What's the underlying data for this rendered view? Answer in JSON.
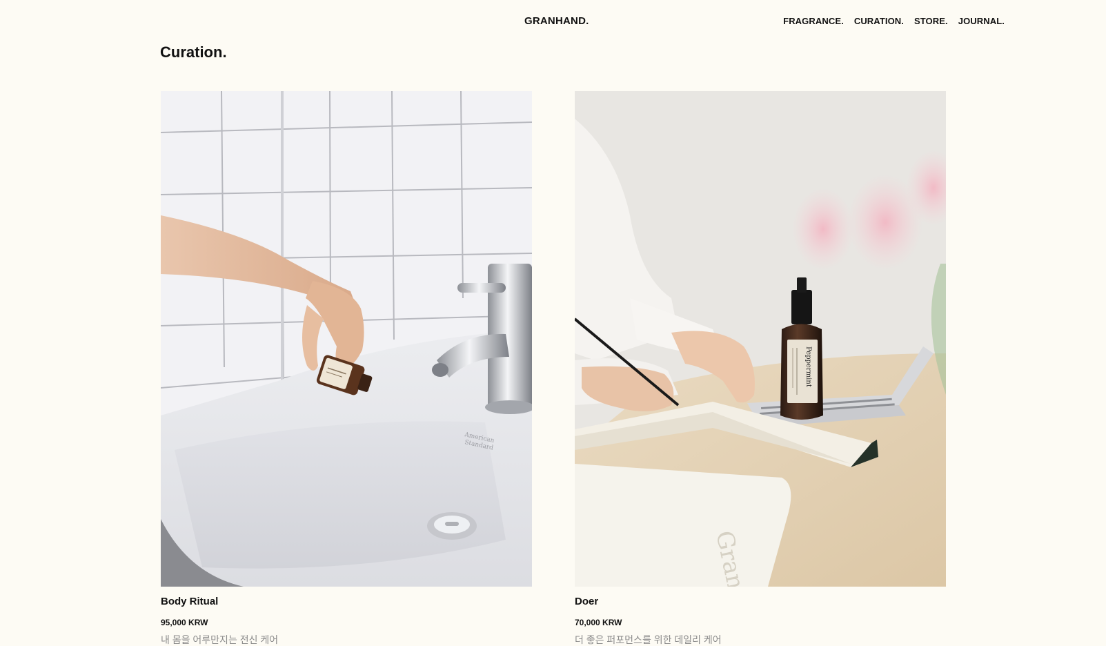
{
  "header": {
    "logo": "GRANHAND.",
    "nav": [
      "FRAGRANCE.",
      "CURATION.",
      "STORE.",
      "JOURNAL."
    ]
  },
  "page_title": "Curation.",
  "products": [
    {
      "name": "Body Ritual",
      "price": "95,000 KRW",
      "description": "내 몸을 어루만지는 전신 케어"
    },
    {
      "name": "Doer",
      "price": "70,000 KRW",
      "description": "더 좋은 퍼포먼스를 위한 데일리 케어"
    }
  ],
  "colors": {
    "background": "#fdfbf4",
    "text": "#111111",
    "muted_text": "#8a8a8a"
  }
}
